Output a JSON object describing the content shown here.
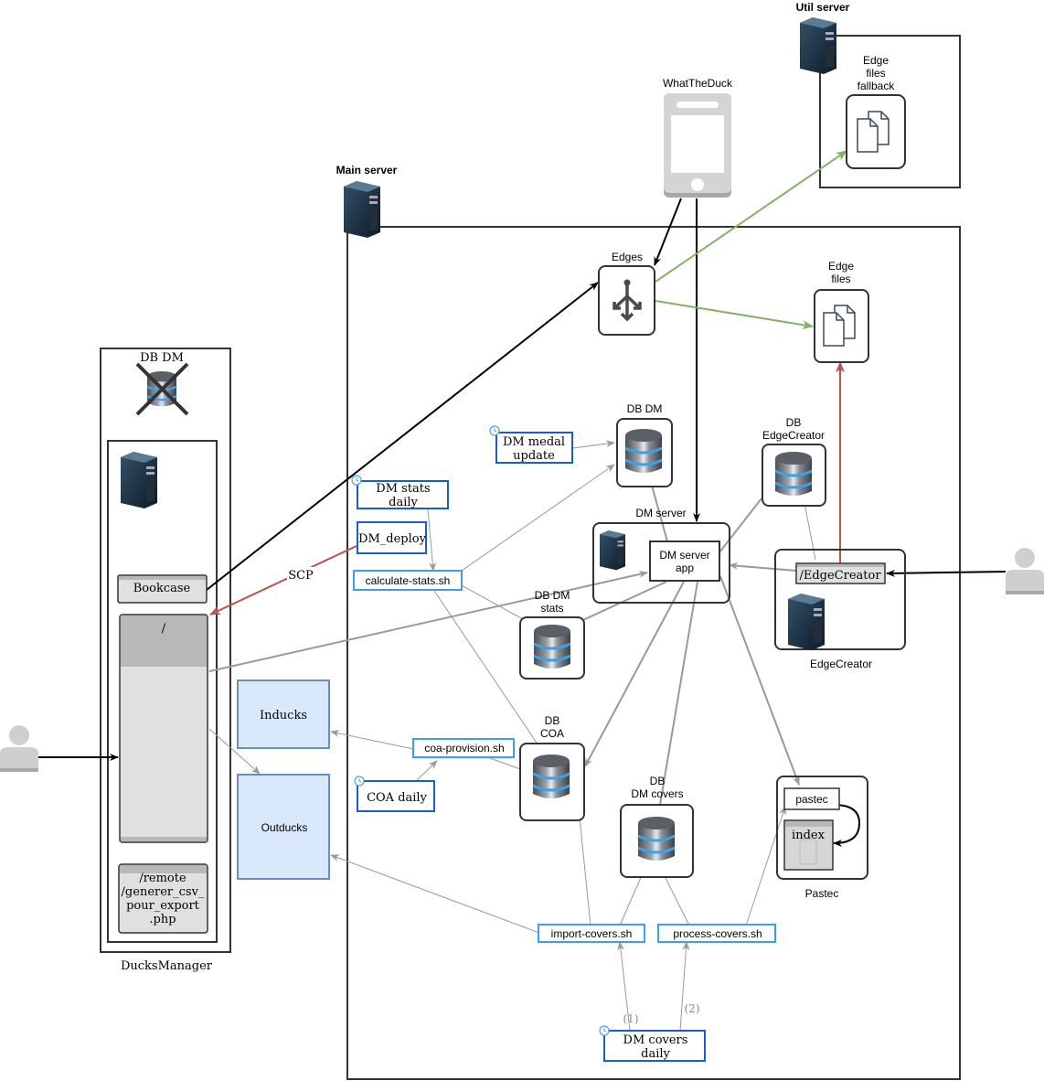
{
  "groups": {
    "util_server": {
      "label": "Util server"
    },
    "main_server": {
      "label": "Main server"
    },
    "ducksmanager": {
      "label": "DucksManager"
    },
    "dm_server": {
      "label": "DM server"
    },
    "edgecreator": {
      "label": "EdgeCreator"
    },
    "pastec": {
      "label": "Pastec"
    }
  },
  "nodes": {
    "edge_files_fallback": [
      "Edge",
      "files",
      "fallback"
    ],
    "whattheduck": "WhatTheDuck",
    "edges": "Edges",
    "edge_files": [
      "Edge",
      "files"
    ],
    "db_dm_old": "DB DM",
    "db_dm": "DB DM",
    "db_edgecreator": [
      "DB",
      "EdgeCreator"
    ],
    "db_dm_stats": [
      "DB DM",
      "stats"
    ],
    "db_coa": [
      "DB",
      "COA"
    ],
    "db_dm_covers": [
      "DB",
      "DM covers"
    ],
    "dm_server_app": [
      "DM server",
      "app"
    ],
    "edgecreator_path": "/EdgeCreator",
    "bookcase": "Bookcase",
    "root_path": "/",
    "remote_path": [
      "/remote",
      "/generer_csv_",
      "pour_export",
      ".php"
    ],
    "inducks": "Inducks",
    "outducks": "Outducks",
    "pastec_app": "pastec",
    "pastec_index": "index"
  },
  "jobs": {
    "dm_medal_update": [
      "DM medal",
      "update"
    ],
    "dm_stats_daily": [
      "DM stats",
      "daily"
    ],
    "dm_deploy": "DM_deploy",
    "coa_daily": "COA daily",
    "dm_covers_daily": [
      "DM covers",
      "daily"
    ]
  },
  "scripts": {
    "calculate_stats": "calculate-stats.sh",
    "coa_provision": "coa-provision.sh",
    "import_covers": "import-covers.sh",
    "process_covers": "process-covers.sh"
  },
  "edge_labels": {
    "scp": "SCP",
    "step1": "(1)",
    "step2": "(2)"
  },
  "colors": {
    "black_edge": "#000000",
    "gray_edge": "#999999",
    "green_edge": "#82b366",
    "red_edge": "#b85450",
    "job_border": "#1a5fc9",
    "script_border": "#3f9ee8",
    "external_fill": "#dae8fc",
    "external_border": "#6c8ebf"
  }
}
